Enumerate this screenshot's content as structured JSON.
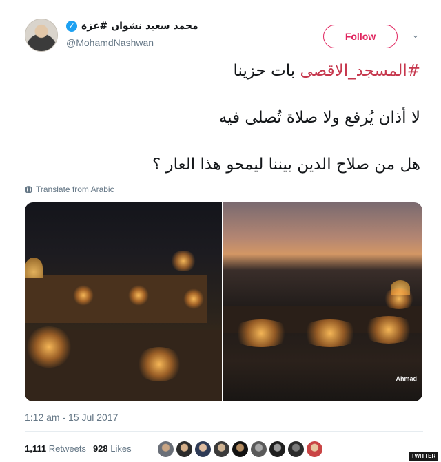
{
  "author": {
    "display_name": "محمد سعيد نشوان #غزة",
    "handle": "@MohamdNashwan",
    "verified": true
  },
  "actions": {
    "follow_label": "Follow"
  },
  "tweet": {
    "hashtag": "#المسجد_الاقصى",
    "line1_rest": " بات حزينا",
    "line2": "لا أذان يُرفع ولا صلاة تُصلى فيه",
    "line3": "هل من صلاح الدين بيننا ليمحو هذا العار ؟"
  },
  "translate_label": "Translate from Arabic",
  "media": {
    "photo_credit": "Ahmad"
  },
  "timestamp": "1:12 am - 15 Jul 2017",
  "stats": {
    "retweets_count": "1,111",
    "retweets_label": "Retweets",
    "likes_count": "928",
    "likes_label": "Likes"
  },
  "source_badge": "TWITTER",
  "colors": {
    "accent": "#e0245e",
    "hashtag": "#c6374d",
    "verified": "#1da1f2",
    "muted": "#657786"
  }
}
